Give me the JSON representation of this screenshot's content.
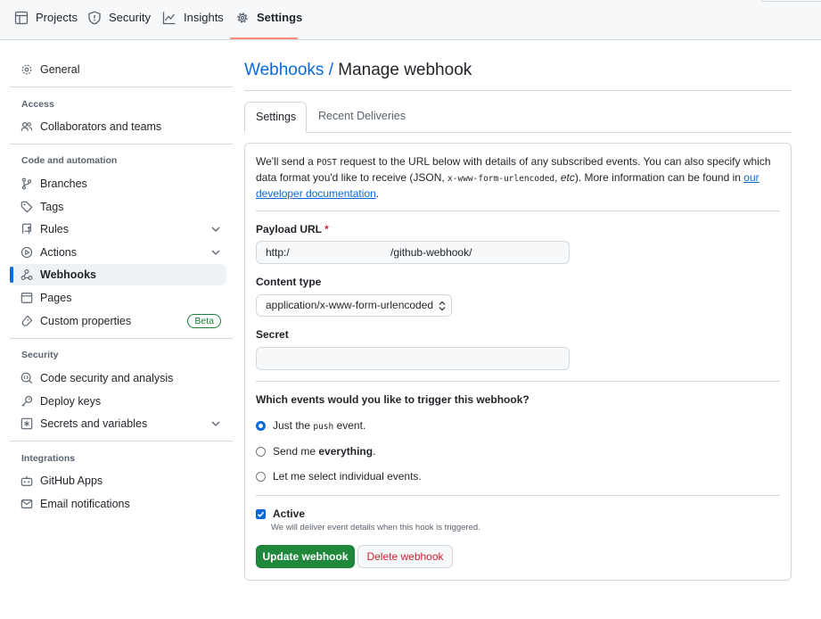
{
  "topnav": {
    "tabs": [
      {
        "label": "Projects",
        "icon": "table-icon"
      },
      {
        "label": "Security",
        "icon": "shield-icon"
      },
      {
        "label": "Insights",
        "icon": "graph-icon"
      },
      {
        "label": "Settings",
        "icon": "gear-icon",
        "selected": true
      }
    ]
  },
  "sidebar": {
    "general": "General",
    "sections": [
      {
        "heading": "Access",
        "items": [
          "Collaborators and teams"
        ]
      },
      {
        "heading": "Code and automation",
        "items": [
          "Branches",
          "Tags",
          "Rules",
          "Actions",
          "Webhooks",
          "Pages",
          "Custom properties"
        ]
      },
      {
        "heading": "Security",
        "items": [
          "Code security and analysis",
          "Deploy keys",
          "Secrets and variables"
        ]
      },
      {
        "heading": "Integrations",
        "items": [
          "GitHub Apps",
          "Email notifications"
        ]
      }
    ],
    "active_item": "Webhooks",
    "beta_label": "Beta"
  },
  "page": {
    "crumb": "Webhooks /",
    "title": "Manage webhook",
    "tabs": [
      "Settings",
      "Recent Deliveries"
    ]
  },
  "form": {
    "desc_1": "We'll send a ",
    "desc_code_post": "POST",
    "desc_2": " request to the URL below with details of any subscribed events. You can also specify which data format you'd like to receive (JSON, ",
    "desc_code_form": "x-www-form-urlencoded",
    "desc_3": ", ",
    "desc_etc": "etc",
    "desc_4": "). More information can be found in ",
    "desc_link": "our developer documentation",
    "desc_5": ".",
    "payload_label": "Payload URL",
    "required_mark": "*",
    "payload_value": "http:/                                  /github-webhook/",
    "content_type_label": "Content type",
    "content_type_value": "application/x-www-form-urlencoded",
    "secret_label": "Secret",
    "secret_value": "",
    "events_question": "Which events would you like to trigger this webhook?",
    "event_opt1_a": "Just the ",
    "event_opt1_code": "push",
    "event_opt1_b": " event.",
    "event_opt2_a": "Send me ",
    "event_opt2_b": "everything",
    "event_opt2_c": ".",
    "event_opt3": "Let me select individual events.",
    "selected_event": 1,
    "active_label": "Active",
    "active_checked": true,
    "active_note": "We will deliver event details when this hook is triggered.",
    "update_button": "Update webhook",
    "delete_button": "Delete webhook"
  }
}
